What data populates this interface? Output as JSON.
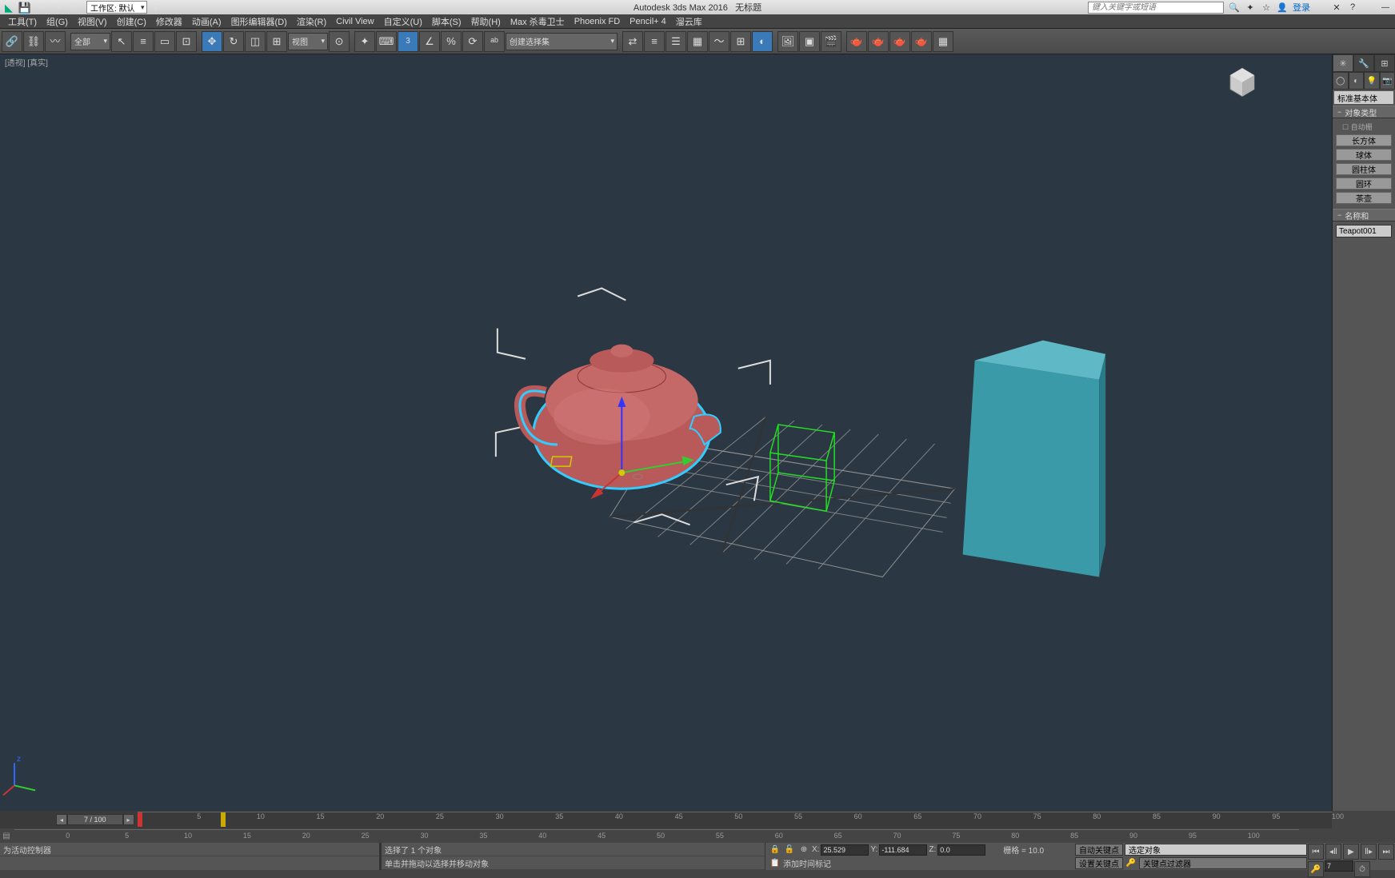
{
  "title": {
    "app": "Autodesk 3ds Max 2016",
    "doc": "无标题"
  },
  "workspace": {
    "label": "工作区: 默认"
  },
  "search": {
    "placeholder": "键入关键字或短语"
  },
  "login": "登录",
  "menu": [
    "工具(T)",
    "组(G)",
    "视图(V)",
    "创建(C)",
    "修改器",
    "动画(A)",
    "图形编辑器(D)",
    "渲染(R)",
    "Civil View",
    "自定义(U)",
    "脚本(S)",
    "帮助(H)",
    "Max 杀毒卫士",
    "Phoenix FD",
    "Pencil+ 4",
    "溜云库"
  ],
  "toolbar": {
    "filter_all": "全部",
    "ref_coord": "视图",
    "named_sel": "创建选择集"
  },
  "viewport": {
    "label": "[透视] [真实]"
  },
  "cmdpanel": {
    "category": "标准基本体",
    "rollout1": "对象类型",
    "auto_grid": "自动栅",
    "geom": [
      "长方体",
      "球体",
      "圆柱体",
      "圆环",
      "茶壶"
    ],
    "rollout2": "名称和",
    "obj_name": "Teapot001"
  },
  "timeline": {
    "current": "7 / 100",
    "ticks": [
      0,
      5,
      10,
      15,
      20,
      25,
      30,
      35,
      40,
      45,
      50,
      55,
      60,
      65,
      70,
      75,
      80,
      85,
      90,
      95,
      100
    ]
  },
  "status": {
    "controller": "为活动控制器",
    "sel": "选择了 1 个对象",
    "hint": "单击并拖动以选择并移动对象",
    "x": "25.529",
    "y": "-111.684",
    "z": "0.0",
    "grid": "栅格 = 10.0",
    "add_marker": "添加时间标记",
    "auto_key": "自动关键点",
    "set_key": "设置关键点",
    "sel_obj": "选定对象",
    "key_filter": "关键点过滤器",
    "frame": "7"
  }
}
